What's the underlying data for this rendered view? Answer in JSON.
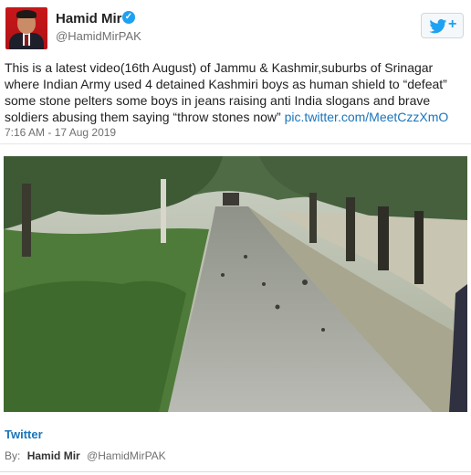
{
  "author": {
    "name": "Hamid Mir",
    "handle": "@HamidMirPAK",
    "verified_icon": "verified-check-icon"
  },
  "follow_button": {
    "icon": "twitter-bird-icon",
    "label": "+"
  },
  "tweet": {
    "text": "This is a latest video(16th August) of Jammu & Kashmir,suburbs of Srinagar where Indian Army used 4 detained Kashmiri boys as human shield to “defeat” some stone pelters some boys in jeans raising anti India slogans and brave soldiers abusing them saying “throw stones now”",
    "link": "pic.twitter.com/MeetCzzXmO",
    "timestamp": "7:16 AM - 17 Aug 2019"
  },
  "footer": {
    "source": "Twitter",
    "by_label": "By:",
    "by_name": "Hamid Mir",
    "by_handle": "@HamidMirPAK"
  },
  "colors": {
    "link": "#1b75bb",
    "twitter_blue": "#1da1f2",
    "avatar_background": "#c8171a"
  }
}
